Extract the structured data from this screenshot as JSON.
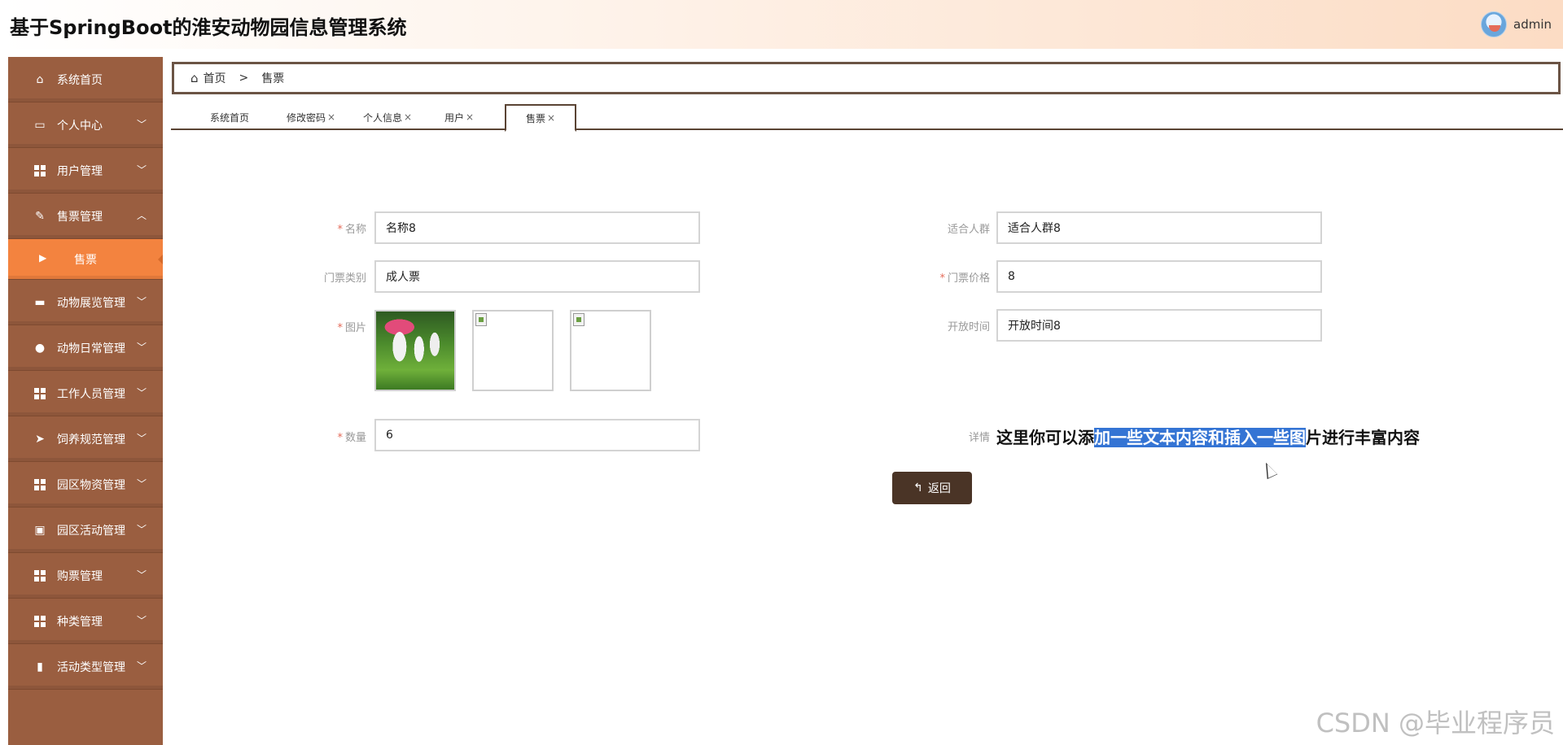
{
  "header": {
    "title": "基于SpringBoot的淮安动物园信息管理系统",
    "user_name": "admin"
  },
  "sidebar": {
    "items": [
      {
        "label": "系统首页",
        "icon": "home-icon",
        "expandable": false
      },
      {
        "label": "个人中心",
        "icon": "card-icon",
        "expandable": true
      },
      {
        "label": "用户管理",
        "icon": "grid-icon",
        "expandable": true
      },
      {
        "label": "售票管理",
        "icon": "thumb-icon",
        "expandable": true,
        "expanded": true
      },
      {
        "label": "售票",
        "icon": "caret-right-icon",
        "sub": true,
        "active": true
      },
      {
        "label": "动物展览管理",
        "icon": "ticket-icon",
        "expandable": true
      },
      {
        "label": "动物日常管理",
        "icon": "user-icon",
        "expandable": true
      },
      {
        "label": "工作人员管理",
        "icon": "grid-icon",
        "expandable": true
      },
      {
        "label": "饲养规范管理",
        "icon": "send-icon",
        "expandable": true
      },
      {
        "label": "园区物资管理",
        "icon": "grid-icon",
        "expandable": true
      },
      {
        "label": "园区活动管理",
        "icon": "clipboard-icon",
        "expandable": true
      },
      {
        "label": "购票管理",
        "icon": "grid-icon",
        "expandable": true
      },
      {
        "label": "种类管理",
        "icon": "grid-icon",
        "expandable": true
      },
      {
        "label": "活动类型管理",
        "icon": "bar-chart-icon",
        "expandable": true
      }
    ]
  },
  "breadcrumb": {
    "home": "首页",
    "separator": ">",
    "current": "售票"
  },
  "tabs": [
    {
      "label": "系统首页",
      "closable": false
    },
    {
      "label": "修改密码",
      "closable": true
    },
    {
      "label": "个人信息",
      "closable": true
    },
    {
      "label": "用户",
      "closable": true
    },
    {
      "label": "售票",
      "closable": true,
      "active": true
    }
  ],
  "tab_close_glyph": "×",
  "form": {
    "name_label": "名称",
    "name_value": "名称8",
    "audience_label": "适合人群",
    "audience_value": "适合人群8",
    "ticket_type_label": "门票类别",
    "ticket_type_value": "成人票",
    "price_label": "门票价格",
    "price_value": "8",
    "image_label": "图片",
    "open_time_label": "开放时间",
    "open_time_value": "开放时间8",
    "quantity_label": "数量",
    "quantity_value": "6",
    "detail_label": "详情",
    "detail_text_before": "这里你可以添",
    "detail_text_selected": "加一些文本内容和插入一些图",
    "detail_text_after": "片进行丰富内容",
    "required_mark": "*"
  },
  "back_button": {
    "icon": "return-icon",
    "label": "返回"
  },
  "watermark": "CSDN @毕业程序员",
  "colors": {
    "sidebar_bg": "#9a5e40",
    "sidebar_active": "#f3833f",
    "button_bg": "#4a3426",
    "selection": "#3474d4",
    "required": "#e46b5a"
  }
}
